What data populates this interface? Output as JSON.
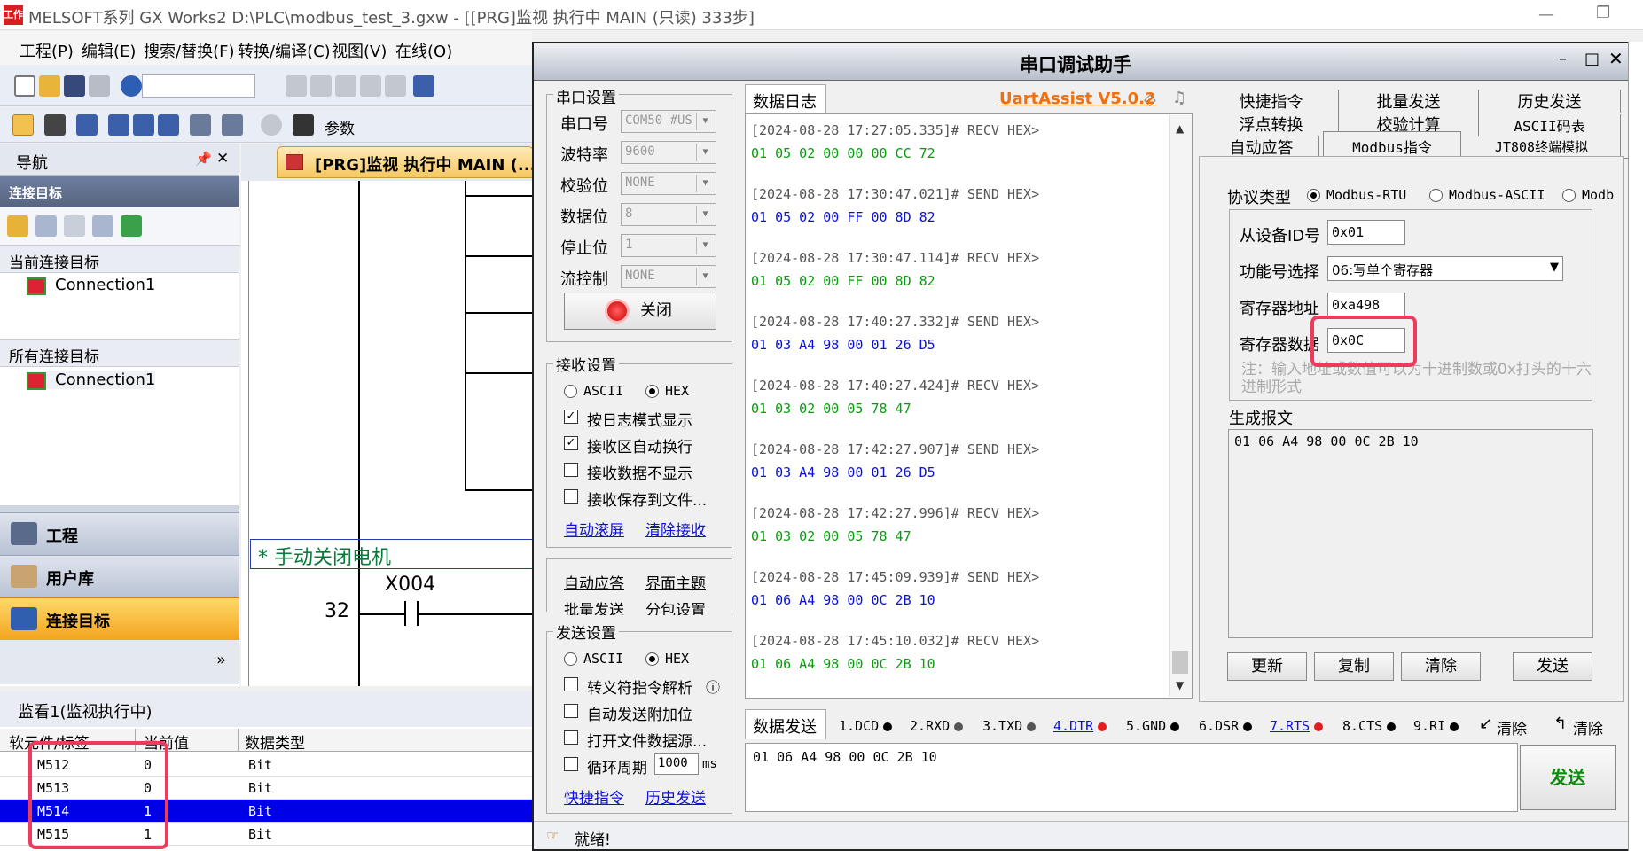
{
  "app": {
    "icon_text": "工作",
    "title": "MELSOFT系列 GX Works2 D:\\PLC\\modbus_test_3.gxw - [[PRG]监视 执行中 MAIN (只读) 333步]",
    "min_icon": "—",
    "max_icon": "❐"
  },
  "menu": [
    "工程(P)",
    "编辑(E)",
    "搜索/替换(F)",
    "转换/编译(C)",
    "视图(V)",
    "在线(O)"
  ],
  "toolbar": {
    "param_label": "参数"
  },
  "nav": {
    "title": "导航",
    "pin_icon": "📌",
    "close_icon": "✕",
    "subheader": "连接目标",
    "current_section": "当前连接目标",
    "current_item": "Connection1",
    "all_section": "所有连接目标",
    "all_item": "Connection1",
    "btn_project": "工程",
    "btn_userlib": "用户库",
    "btn_target": "连接目标",
    "expand_icon": "»"
  },
  "editor": {
    "tab_title": "[PRG]监视 执行中 MAIN (...",
    "comment": "* 手动关闭电机",
    "contact_label": "X004",
    "step_number": "32"
  },
  "watch": {
    "title": "监看1(监视执行中)",
    "columns": [
      "软元件/标签",
      "当前值",
      "数据类型"
    ],
    "rows": [
      {
        "device": "M512",
        "value": "0",
        "type": "Bit",
        "selected": false
      },
      {
        "device": "M513",
        "value": "0",
        "type": "Bit",
        "selected": false
      },
      {
        "device": "M514",
        "value": "1",
        "type": "Bit",
        "selected": true
      },
      {
        "device": "M515",
        "value": "1",
        "type": "Bit",
        "selected": false
      }
    ]
  },
  "dialog": {
    "title": "串口调试助手",
    "min": "–",
    "max": "□",
    "close": "✕",
    "serial": {
      "group": "串口设置",
      "port_label": "串口号",
      "port_value": "COM50 #US",
      "baud_label": "波特率",
      "baud_value": "9600",
      "parity_label": "校验位",
      "parity_value": "NONE",
      "data_label": "数据位",
      "data_value": "8",
      "stop_label": "停止位",
      "stop_value": "1",
      "flow_label": "流控制",
      "flow_value": "NONE",
      "close_btn": "关闭"
    },
    "recv": {
      "group": "接收设置",
      "ascii": "ASCII",
      "hex": "HEX",
      "log_mode": "按日志模式显示",
      "auto_wrap": "接收区自动换行",
      "no_display": "接收数据不显示",
      "save_file": "接收保存到文件...",
      "auto_scroll": "自动滚屏",
      "clear_recv": "清除接收"
    },
    "misc": {
      "auto_reply": "自动应答",
      "theme": "界面主题",
      "batch_send": "批量发送",
      "packet": "分包设置"
    },
    "send": {
      "group": "发送设置",
      "ascii": "ASCII",
      "hex": "HEX",
      "escape": "转义符指令解析",
      "append": "自动发送附加位",
      "open_file": "打开文件数据源...",
      "cycle": "循环周期",
      "cycle_value": "1000",
      "cycle_unit": "ms",
      "quick_cmd": "快捷指令",
      "history": "历史发送",
      "check": "✓",
      "info_icon": "ⓘ"
    },
    "log": {
      "tab": "数据日志",
      "version": "UartAssist V5.0.2",
      "lines": [
        {
          "head": "[2024-08-28 17:27:05.335]# RECV HEX>",
          "data": "01 05 02 00 00 00 CC 72",
          "kind": "r"
        },
        {
          "head": "[2024-08-28 17:30:47.021]# SEND HEX>",
          "data": "01 05 02 00 FF 00 8D 82",
          "kind": "s"
        },
        {
          "head": "[2024-08-28 17:30:47.114]# RECV HEX>",
          "data": "01 05 02 00 FF 00 8D 82",
          "kind": "r"
        },
        {
          "head": "[2024-08-28 17:40:27.332]# SEND HEX>",
          "data": "01 03 A4 98 00 01 26 D5",
          "kind": "s"
        },
        {
          "head": "[2024-08-28 17:40:27.424]# RECV HEX>",
          "data": "01 03 02 00 05 78 47",
          "kind": "r"
        },
        {
          "head": "[2024-08-28 17:42:27.907]# SEND HEX>",
          "data": "01 03 A4 98 00 01 26 D5",
          "kind": "s"
        },
        {
          "head": "[2024-08-28 17:42:27.996]# RECV HEX>",
          "data": "01 03 02 00 05 78 47",
          "kind": "r"
        },
        {
          "head": "[2024-08-28 17:45:09.939]# SEND HEX>",
          "data": "01 06 A4 98 00 0C 2B 10",
          "kind": "s"
        },
        {
          "head": "[2024-08-28 17:45:10.032]# RECV HEX>",
          "data": "01 06 A4 98 00 0C 2B 10",
          "kind": "r"
        }
      ]
    },
    "tabs_row1": [
      "快捷指令",
      "批量发送",
      "历史发送"
    ],
    "tabs_row2": [
      "浮点转换",
      "校验计算",
      "ASCII码表"
    ],
    "tabs_row3": [
      "自动应答",
      "Modbus指令",
      "JT808终端模拟"
    ],
    "modbus": {
      "proto_label": "协议类型",
      "proto_rtu": "Modbus-RTU",
      "proto_ascii": "Modbus-ASCII",
      "proto_more": "Modb",
      "slave_label": "从设备ID号",
      "slave_value": "0x01",
      "func_label": "功能号选择",
      "func_value": "06:写单个寄存器",
      "addr_label": "寄存器地址",
      "addr_value": "0xa498",
      "data_label": "寄存器数据",
      "data_value": "0x0C",
      "note": "注：输入地址或数值可以为十进制数或0x打头的十六进制形式",
      "gen_label": "生成报文",
      "gen_value": "01 06 A4 98 00 0C 2B 10",
      "btn_update": "更新",
      "btn_copy": "复制",
      "btn_clear": "清除",
      "btn_send": "发送"
    },
    "sendbar": {
      "tab": "数据发送",
      "pins": [
        {
          "label": "1.DCD",
          "color": "#000000",
          "link": false
        },
        {
          "label": "2.RXD",
          "color": "#555555",
          "link": false
        },
        {
          "label": "3.TXD",
          "color": "#555555",
          "link": false
        },
        {
          "label": "4.DTR",
          "color": "#e02020",
          "link": true
        },
        {
          "label": "5.GND",
          "color": "#000000",
          "link": false
        },
        {
          "label": "6.DSR",
          "color": "#000000",
          "link": false
        },
        {
          "label": "7.RTS",
          "color": "#e02020",
          "link": true
        },
        {
          "label": "8.CTS",
          "color": "#000000",
          "link": false
        },
        {
          "label": "9.RI",
          "color": "#000000",
          "link": false
        }
      ],
      "clear1": "清除",
      "clear2": "清除",
      "input_value": "01 06 A4 98 00 0C 2B 10",
      "send_btn": "发送"
    },
    "status": "就绪!"
  }
}
